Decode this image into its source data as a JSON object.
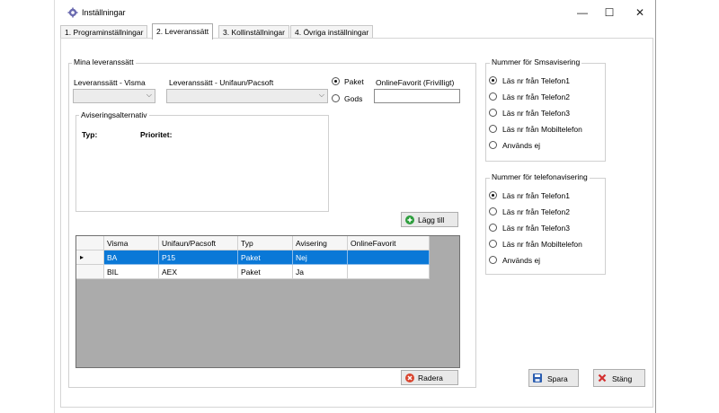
{
  "window": {
    "title": "Inställningar",
    "minimize": "—",
    "maximize": "☐",
    "close": "✕"
  },
  "tabs": [
    {
      "label": "1. Programinställningar"
    },
    {
      "label": "2. Leveranssätt"
    },
    {
      "label": "3. Kollinställningar"
    },
    {
      "label": "4. Övriga inställningar"
    }
  ],
  "delivery": {
    "group_title": "Mina leveranssätt",
    "visma_label": "Leveranssätt - Visma",
    "unifaun_label": "Leveranssätt - Unifaun/Pacsoft",
    "radio_paket": "Paket",
    "radio_gods": "Gods",
    "online_label": "OnlineFavorit (Frivilligt)",
    "online_value": "",
    "notif_group_title": "Aviseringsalternativ",
    "typ_label": "Typ:",
    "prioritet_label": "Prioritet:",
    "add_button": "Lägg till",
    "delete_button": "Radera"
  },
  "grid": {
    "columns": [
      "Visma",
      "Unifaun/Pacsoft",
      "Typ",
      "Avisering",
      "OnlineFavorit"
    ],
    "rows": [
      [
        "BA",
        "P15",
        "Paket",
        "Nej",
        ""
      ],
      [
        "BIL",
        "AEX",
        "Paket",
        "Ja",
        ""
      ]
    ],
    "current_row_marker": "▸"
  },
  "sms": {
    "title": "Nummer för Smsavisering",
    "options": [
      "Läs nr från Telefon1",
      "Läs nr från Telefon2",
      "Läs nr från Telefon3",
      "Läs nr från Mobiltelefon",
      "Används ej"
    ],
    "selected": 0
  },
  "phone": {
    "title": "Nummer för telefonavisering",
    "options": [
      "Läs nr från Telefon1",
      "Läs nr från Telefon2",
      "Läs nr från Telefon3",
      "Läs nr från Mobiltelefon",
      "Används ej"
    ],
    "selected": 0
  },
  "actions": {
    "save": "Spara",
    "close": "Stäng"
  },
  "colors": {
    "selection": "#0a78d7",
    "add_icon": "#2e9e3e",
    "delete_icon": "#d9452f",
    "save_icon": "#2a5db0",
    "close_icon": "#d32f2f"
  },
  "icons": {
    "title": "gear-icon",
    "add": "plus-circle-icon",
    "delete": "x-circle-icon",
    "save": "floppy-disk-icon",
    "close": "x-mark-icon"
  }
}
